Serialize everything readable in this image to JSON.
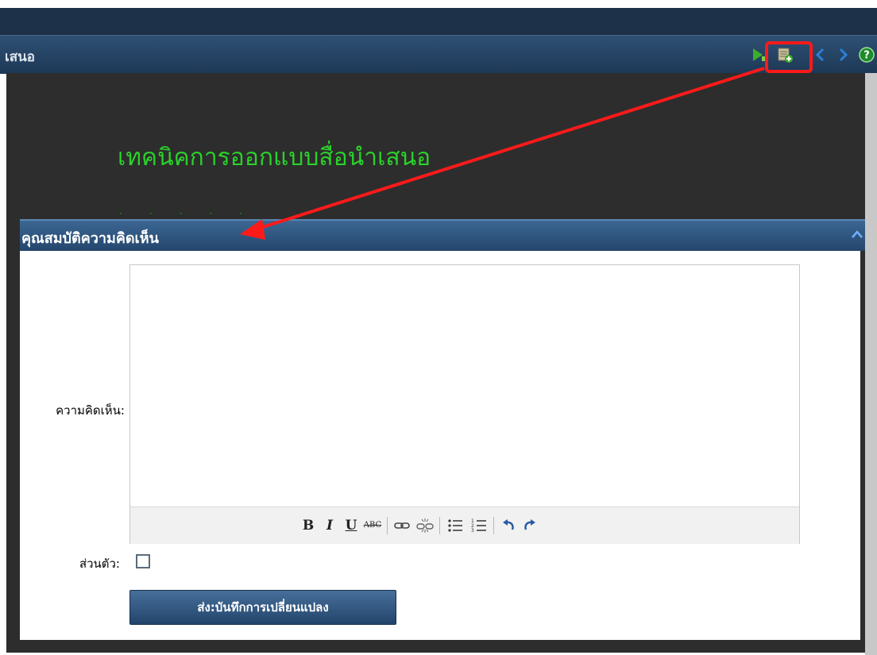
{
  "window": {
    "title": "เสนอ"
  },
  "toolbar_icons": [
    "next-slide-icon",
    "add-comment-icon",
    "previous-arrow-icon",
    "next-arrow-icon",
    "help-icon"
  ],
  "slide": {
    "title": "เทคนิคการออกแบบสื่อนำเสนอ"
  },
  "dialog": {
    "title": "คุณสมบัติความคิดเห็น",
    "comment_label": "ความคิดเห็น:",
    "comment_value": "",
    "editor_tools": [
      "bold-icon",
      "italic-icon",
      "underline-icon",
      "strikethrough-icon",
      "link-icon",
      "unlink-icon",
      "bullet-list-icon",
      "numbered-list-icon",
      "undo-icon",
      "redo-icon"
    ],
    "private_label": "ส่วนตัว:",
    "private_checked": false,
    "submit_label": "ส่ง:บันทึกการเปลี่ยนแปลง"
  },
  "colors": {
    "titlebar": "#1d3856",
    "slide_background": "#2d2d2d",
    "slide_title": "#2ad12a",
    "dialog_header": "#24466d",
    "annotation": "#ff1a1a"
  }
}
